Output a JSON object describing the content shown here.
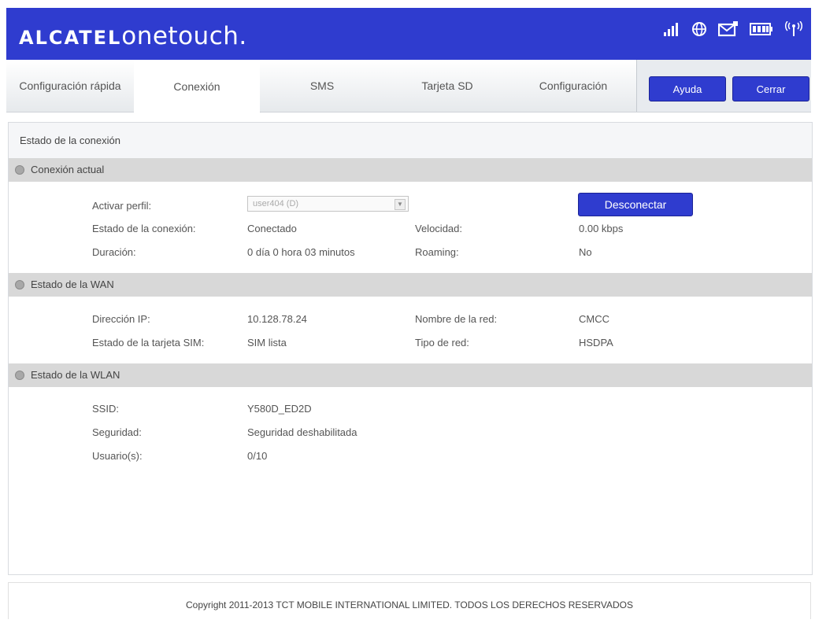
{
  "header": {
    "brand_prefix": "ALCATEL",
    "brand_suffix": "onetouch.",
    "icons": [
      "signal-icon",
      "globe-icon",
      "message-icon",
      "battery-icon",
      "wifi-icon"
    ]
  },
  "tabs": [
    {
      "label": "Configuración rápida"
    },
    {
      "label": "Conexión",
      "active": true
    },
    {
      "label": "SMS"
    },
    {
      "label": "Tarjeta SD"
    },
    {
      "label": "Configuración"
    }
  ],
  "buttons": {
    "help": "Ayuda",
    "close": "Cerrar",
    "disconnect": "Desconectar"
  },
  "panel": {
    "title": "Estado de la conexión"
  },
  "current_connection": {
    "heading": "Conexión actual",
    "profile_label": "Activar perfil:",
    "profile_value": "user404 (D)",
    "state_label": "Estado de la conexión:",
    "state_value": "Conectado",
    "speed_label": "Velocidad:",
    "speed_value": "0.00 kbps",
    "duration_label": "Duración:",
    "duration_value": "0 día 0 hora 03 minutos",
    "roaming_label": "Roaming:",
    "roaming_value": "No"
  },
  "wan": {
    "heading": "Estado de la WAN",
    "ip_label": "Dirección IP:",
    "ip_value": "10.128.78.24",
    "network_name_label": "Nombre de la red:",
    "network_name_value": "CMCC",
    "sim_label": "Estado de la tarjeta SIM:",
    "sim_value": "SIM lista",
    "network_type_label": "Tipo de red:",
    "network_type_value": "HSDPA"
  },
  "wlan": {
    "heading": "Estado de la WLAN",
    "ssid_label": "SSID:",
    "ssid_value": "Y580D_ED2D",
    "security_label": "Seguridad:",
    "security_value": "Seguridad deshabilitada",
    "users_label": "Usuario(s):",
    "users_value": "0/10"
  },
  "footer": {
    "copyright": "Copyright 2011-2013 TCT MOBILE INTERNATIONAL LIMITED. TODOS LOS DERECHOS RESERVADOS"
  }
}
